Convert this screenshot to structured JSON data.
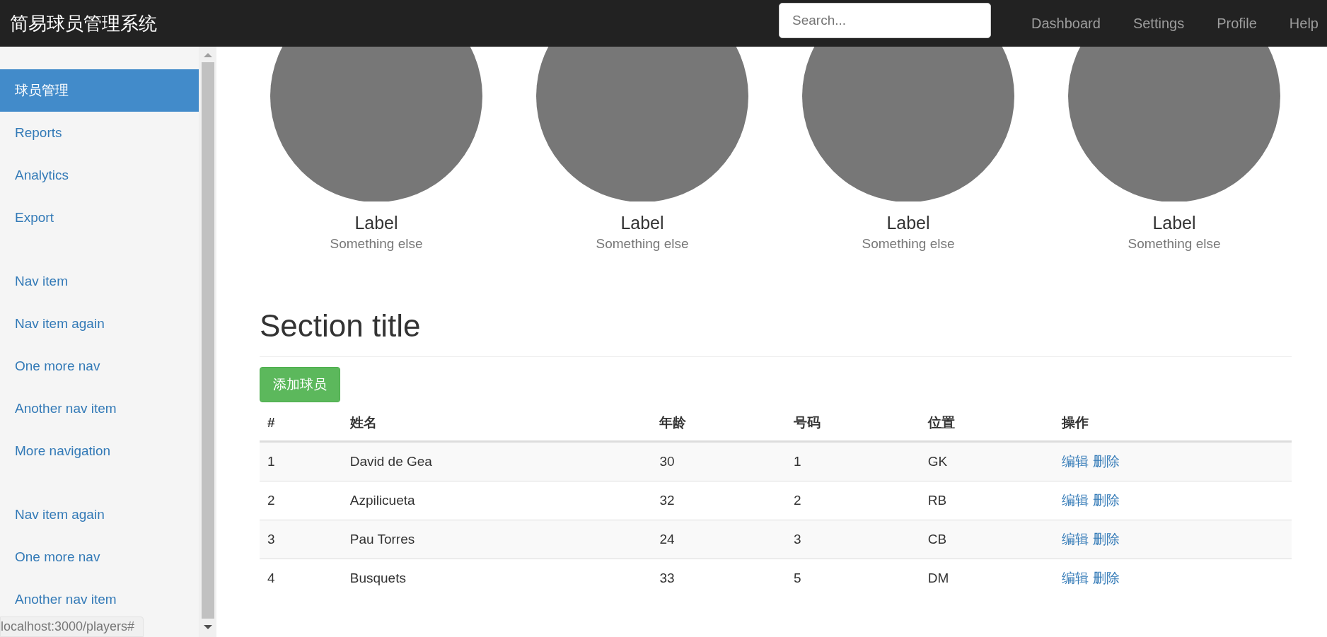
{
  "navbar": {
    "brand": "简易球员管理系统",
    "search": {
      "placeholder": "Search..."
    },
    "links": [
      "Dashboard",
      "Settings",
      "Profile",
      "Help"
    ]
  },
  "sidebar": {
    "groups": [
      {
        "items": [
          {
            "label": "球员管理",
            "selected": true
          },
          {
            "label": "Reports",
            "selected": false
          },
          {
            "label": "Analytics",
            "selected": false
          },
          {
            "label": "Export",
            "selected": false
          }
        ]
      },
      {
        "items": [
          {
            "label": "Nav item",
            "selected": false
          },
          {
            "label": "Nav item again",
            "selected": false
          },
          {
            "label": "One more nav",
            "selected": false
          },
          {
            "label": "Another nav item",
            "selected": false
          },
          {
            "label": "More navigation",
            "selected": false
          }
        ]
      },
      {
        "items": [
          {
            "label": "Nav item again",
            "selected": false
          },
          {
            "label": "One more nav",
            "selected": false
          },
          {
            "label": "Another nav item",
            "selected": false
          }
        ]
      }
    ]
  },
  "placeholders": [
    {
      "label": "Label",
      "sublabel": "Something else"
    },
    {
      "label": "Label",
      "sublabel": "Something else"
    },
    {
      "label": "Label",
      "sublabel": "Something else"
    },
    {
      "label": "Label",
      "sublabel": "Something else"
    }
  ],
  "section_title": "Section title",
  "add_button": "添加球员",
  "table": {
    "columns": [
      "#",
      "姓名",
      "年龄",
      "号码",
      "位置",
      "操作"
    ],
    "rows": [
      {
        "cells": [
          "1",
          "David de Gea",
          "30",
          "1",
          "GK"
        ],
        "actions": [
          "编辑",
          "删除"
        ]
      },
      {
        "cells": [
          "2",
          "Azpilicueta",
          "32",
          "2",
          "RB"
        ],
        "actions": [
          "编辑",
          "删除"
        ]
      },
      {
        "cells": [
          "3",
          "Pau Torres",
          "24",
          "3",
          "CB"
        ],
        "actions": [
          "编辑",
          "删除"
        ]
      },
      {
        "cells": [
          "4",
          "Busquets",
          "33",
          "5",
          "DM"
        ],
        "actions": [
          "编辑",
          "删除"
        ]
      }
    ]
  },
  "status_bar": "localhost:3000/players#"
}
